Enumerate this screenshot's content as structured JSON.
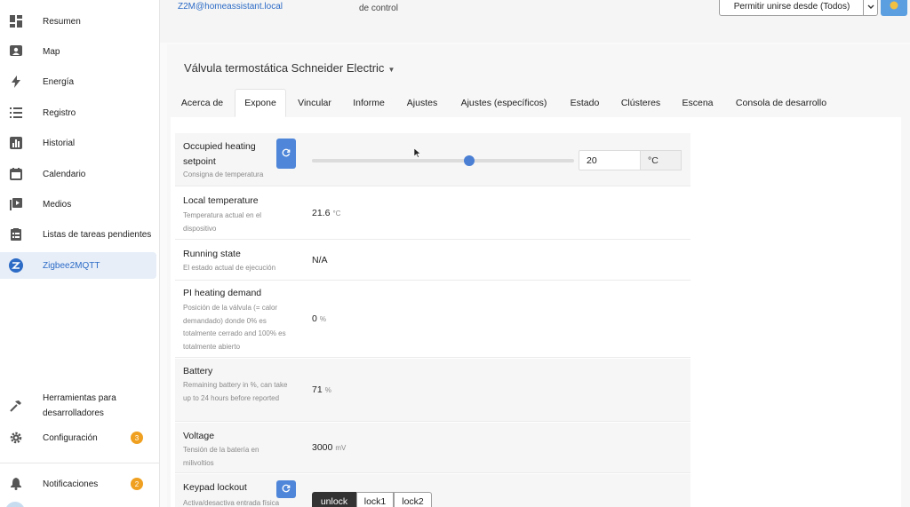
{
  "sidebar": {
    "items": [
      {
        "label": "Resumen",
        "icon": "dashboard-icon"
      },
      {
        "label": "Map",
        "icon": "map-icon"
      },
      {
        "label": "Energía",
        "icon": "lightning-icon"
      },
      {
        "label": "Registro",
        "icon": "list-icon"
      },
      {
        "label": "Historial",
        "icon": "chart-icon"
      },
      {
        "label": "Calendario",
        "icon": "calendar-icon"
      },
      {
        "label": "Medios",
        "icon": "media-icon"
      },
      {
        "label": "Listas de tareas pendientes",
        "icon": "clipboard-icon"
      },
      {
        "label": "Zigbee2MQTT",
        "icon": "zigbee-icon",
        "active": true
      }
    ],
    "bottom": [
      {
        "label": "Herramientas para desarrolladores",
        "icon": "hammer-icon"
      },
      {
        "label": "Configuración",
        "icon": "gear-icon",
        "badge": "3"
      },
      {
        "label": "Notificaciones",
        "icon": "bell-icon",
        "badge": "2"
      }
    ]
  },
  "topbar": {
    "z2m_link": "Z2M@homeassistant.local",
    "control_text": "de control",
    "permit_join": "Permitir unirse desde (Todos)"
  },
  "device": {
    "title": "Válvula termostática Schneider Electric"
  },
  "tabs": [
    "Acerca de",
    "Expone",
    "Vincular",
    "Informe",
    "Ajustes",
    "Ajustes (específicos)",
    "Estado",
    "Clústeres",
    "Escena",
    "Consola de desarrollo"
  ],
  "active_tab": "Expone",
  "exposes": {
    "setpoint": {
      "label": "Occupied heating setpoint",
      "desc": "Consigna de temperatura",
      "value": "20",
      "unit": "°C",
      "slider_fraction": 0.6
    },
    "local_temperature": {
      "label": "Local temperature",
      "desc": "Temperatura actual en el dispositivo",
      "value": "21.6",
      "unit": "°C"
    },
    "running_state": {
      "label": "Running state",
      "desc": "El estado actual de ejecución",
      "value": "N/A"
    },
    "pi_heating_demand": {
      "label": "PI heating demand",
      "desc": "Posición de la válvula (= calor demandado) donde 0% es totalmente cerrado and 100% es totalmente abierto",
      "value": "0",
      "unit": "%"
    },
    "battery": {
      "label": "Battery",
      "desc": "Remaining battery in %, can take up to 24 hours before reported",
      "value": "71",
      "unit": "%"
    },
    "voltage": {
      "label": "Voltage",
      "desc": "Tensión de la batería en milivoltios",
      "value": "3000",
      "unit": "mV"
    },
    "keypad_lockout": {
      "label": "Keypad lockout",
      "desc": "Activa/desactiva entrada física",
      "options": [
        "unlock",
        "lock1",
        "lock2"
      ],
      "selected": "unlock"
    }
  },
  "colors": {
    "accent": "#4f86d9",
    "active_nav_bg": "#e7eef8",
    "badge": "#f0a020"
  }
}
